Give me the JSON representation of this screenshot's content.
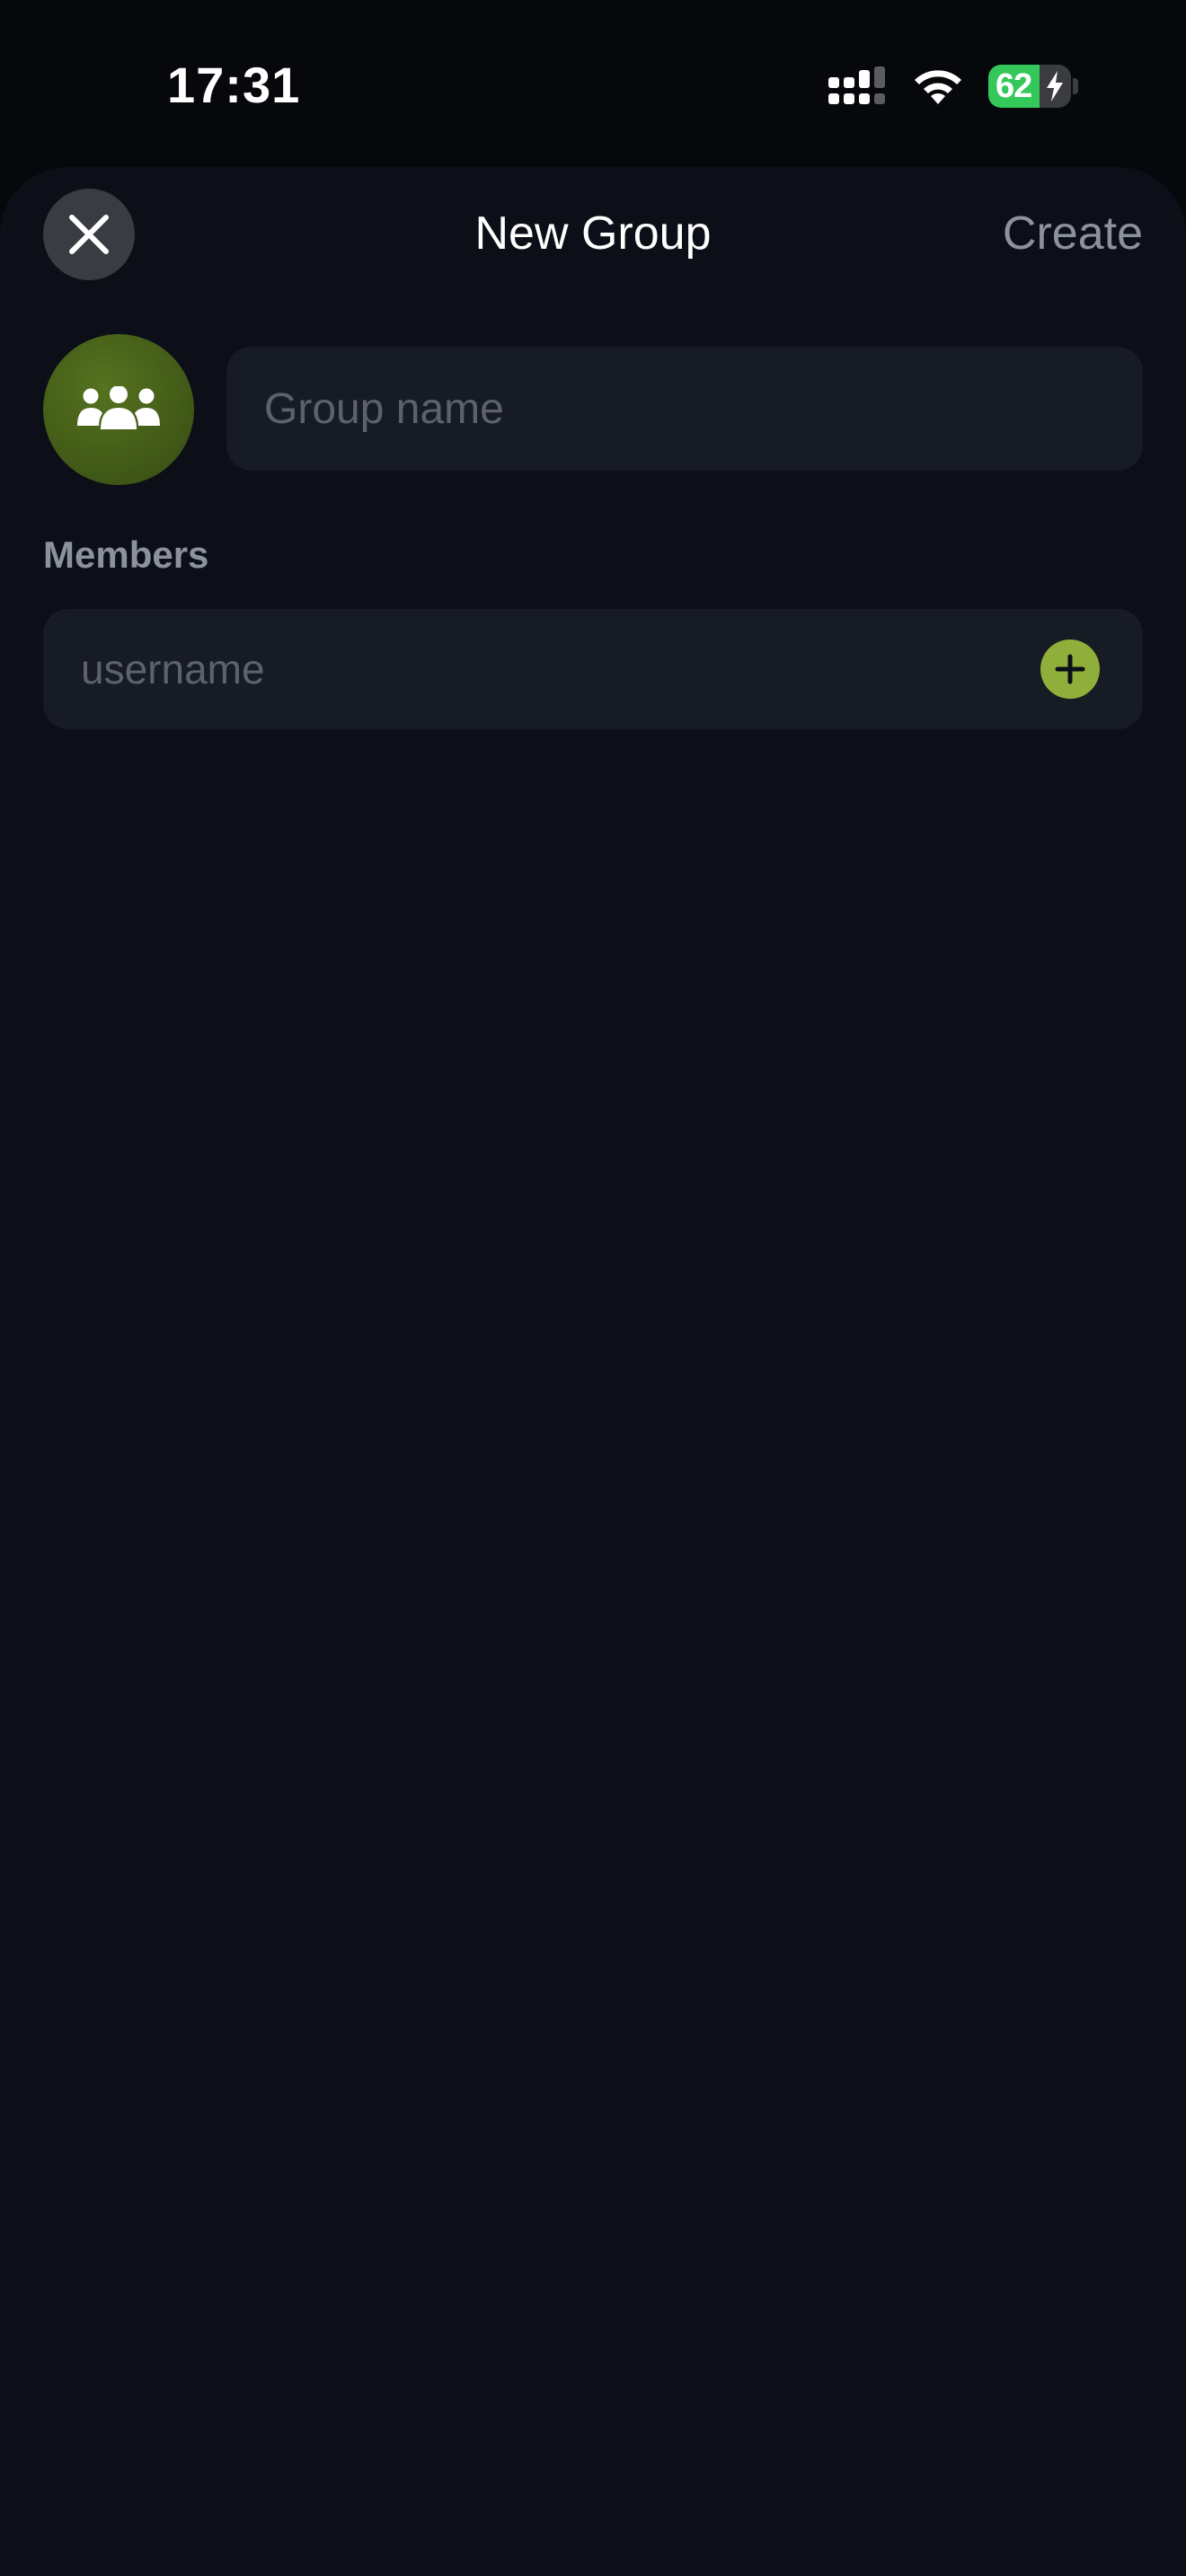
{
  "status_bar": {
    "time": "17:31",
    "battery_text": "62",
    "battery_level": 0.62,
    "icons": [
      "cellular-signal-icon",
      "wifi-icon",
      "battery-icon",
      "charging-bolt-icon"
    ]
  },
  "sheet": {
    "title": "New Group",
    "close_icon": "close-icon",
    "create_label": "Create"
  },
  "group": {
    "avatar_icon": "group-people-icon",
    "name_placeholder": "Group name",
    "name_value": ""
  },
  "members": {
    "label": "Members",
    "input_placeholder": "username",
    "input_value": "",
    "add_icon": "plus-icon"
  },
  "colors": {
    "background": "#0c0f17",
    "field": "#171b24",
    "accent": "#8fae3a",
    "avatar": "#4a6419",
    "battery_green": "#34c759",
    "muted_text": "#8c929c"
  }
}
